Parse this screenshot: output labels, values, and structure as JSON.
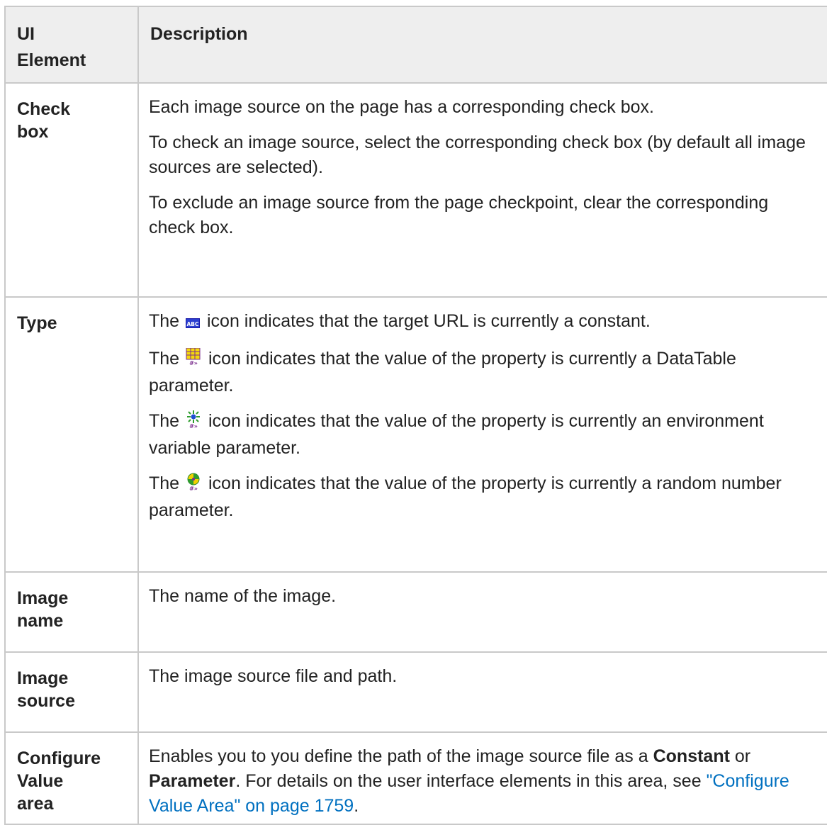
{
  "table": {
    "headers": [
      "UI\nElement",
      "Description"
    ],
    "rows": [
      {
        "element": "Check\nbox",
        "paragraphs": [
          "Each image source on the page has a corresponding check box.",
          "To check an image source, select the corresponding check box (by default all image sources are selected).",
          "To exclude an image source from the page checkpoint, clear the corresponding check box."
        ]
      },
      {
        "element": "Type",
        "icon_lines": [
          {
            "prefix": "The",
            "icon": "constant-abc-icon",
            "text": "icon indicates that the target URL is currently a constant."
          },
          {
            "prefix": "The",
            "icon": "datatable-parameter-icon",
            "text": "icon indicates that the value of the property is currently a DataTable parameter."
          },
          {
            "prefix": "The",
            "icon": "environment-variable-parameter-icon",
            "text": "icon indicates that the value of the property is currently an environment variable parameter."
          },
          {
            "prefix": "The",
            "icon": "random-number-parameter-icon",
            "text": "icon indicates that the value of the property is currently a random number parameter."
          }
        ]
      },
      {
        "element": "Image\nname",
        "paragraphs": [
          "The name of the image."
        ]
      },
      {
        "element": "Image\nsource",
        "paragraphs": [
          "The image source file and path."
        ]
      },
      {
        "element": "Configure\nValue\narea",
        "rich": {
          "t1": "Enables you to you define the path of the image source file as a",
          "b1": "Constant",
          "t2": "or",
          "b2": "Parameter",
          "t3": ". For details on the user interface elements in this area, see",
          "link": "\"Configure Value Area\" on page 1759",
          "t4": "."
        }
      }
    ]
  }
}
